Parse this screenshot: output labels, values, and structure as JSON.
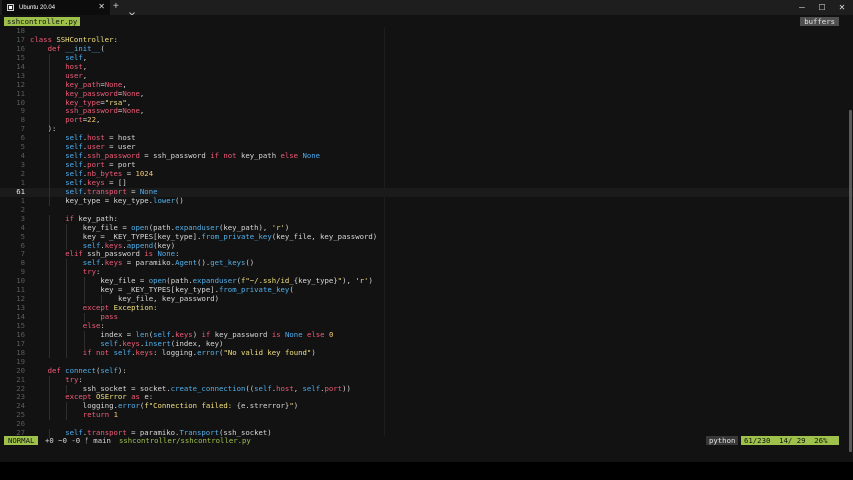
{
  "window": {
    "tab_title": "Ubuntu 20.04",
    "tab_icon": "terminal-icon",
    "close_tab_glyph": "✕",
    "new_tab_glyph": "+",
    "minimize_glyph": "─",
    "maximize_glyph": "☐",
    "close_glyph": "✕"
  },
  "editor": {
    "buffer_name": "sshcontroller.py",
    "buffers_label": "buffers",
    "cursor_line": 61,
    "lines": [
      {
        "n": "18",
        "segs": []
      },
      {
        "n": "17",
        "segs": [
          [
            "kw",
            "class "
          ],
          [
            "cls",
            "SSHController"
          ],
          [
            "",
            ":"
          ]
        ]
      },
      {
        "n": "16",
        "i": 1,
        "segs": [
          [
            "kw",
            "def "
          ],
          [
            "fn",
            "__init__"
          ],
          [
            "",
            "("
          ]
        ]
      },
      {
        "n": "15",
        "i": 2,
        "segs": [
          [
            "sf",
            "self"
          ],
          [
            "",
            ","
          ]
        ]
      },
      {
        "n": "14",
        "i": 2,
        "segs": [
          [
            "pr",
            "host"
          ],
          [
            "",
            ","
          ]
        ]
      },
      {
        "n": "13",
        "i": 2,
        "segs": [
          [
            "pr",
            "user"
          ],
          [
            "",
            ","
          ]
        ]
      },
      {
        "n": "12",
        "i": 2,
        "segs": [
          [
            "pr",
            "key_path"
          ],
          [
            "",
            "="
          ],
          [
            "kw",
            "None"
          ],
          [
            "",
            ","
          ]
        ]
      },
      {
        "n": "11",
        "i": 2,
        "segs": [
          [
            "pr",
            "key_password"
          ],
          [
            "",
            "="
          ],
          [
            "kw",
            "None"
          ],
          [
            "",
            ","
          ]
        ]
      },
      {
        "n": "10",
        "i": 2,
        "segs": [
          [
            "pr",
            "key_type"
          ],
          [
            "",
            "="
          ],
          [
            "st",
            "\"rsa\""
          ],
          [
            "",
            ","
          ]
        ]
      },
      {
        "n": "9",
        "i": 2,
        "segs": [
          [
            "pr",
            "ssh_password"
          ],
          [
            "",
            "="
          ],
          [
            "kw",
            "None"
          ],
          [
            "",
            ","
          ]
        ]
      },
      {
        "n": "8",
        "i": 2,
        "segs": [
          [
            "pr",
            "port"
          ],
          [
            "",
            "="
          ],
          [
            "nm",
            "22"
          ],
          [
            "",
            ","
          ]
        ]
      },
      {
        "n": "7",
        "i": 1,
        "segs": [
          [
            "",
            "):"
          ]
        ]
      },
      {
        "n": "6",
        "i": 2,
        "segs": [
          [
            "sf",
            "self"
          ],
          [
            "",
            "."
          ],
          [
            "pr",
            "host"
          ],
          [
            "",
            " = host"
          ]
        ]
      },
      {
        "n": "5",
        "i": 2,
        "segs": [
          [
            "sf",
            "self"
          ],
          [
            "",
            "."
          ],
          [
            "pr",
            "user"
          ],
          [
            "",
            " = user"
          ]
        ]
      },
      {
        "n": "4",
        "i": 2,
        "segs": [
          [
            "sf",
            "self"
          ],
          [
            "",
            "."
          ],
          [
            "pr",
            "ssh_password"
          ],
          [
            "",
            " = ssh_password "
          ],
          [
            "kw",
            "if not"
          ],
          [
            "",
            " key_path "
          ],
          [
            "kw",
            "else"
          ],
          [
            "",
            " "
          ],
          [
            "sf",
            "None"
          ]
        ]
      },
      {
        "n": "3",
        "i": 2,
        "segs": [
          [
            "sf",
            "self"
          ],
          [
            "",
            "."
          ],
          [
            "pr",
            "port"
          ],
          [
            "",
            " = port"
          ]
        ]
      },
      {
        "n": "2",
        "i": 2,
        "segs": [
          [
            "sf",
            "self"
          ],
          [
            "",
            "."
          ],
          [
            "pr",
            "nb_bytes"
          ],
          [
            "",
            " = "
          ],
          [
            "nm",
            "1024"
          ]
        ]
      },
      {
        "n": "1",
        "i": 2,
        "segs": [
          [
            "sf",
            "self"
          ],
          [
            "",
            "."
          ],
          [
            "pr",
            "keys"
          ],
          [
            "",
            " = []"
          ]
        ]
      },
      {
        "n": "61",
        "i": 2,
        "cur": true,
        "segs": [
          [
            "sf",
            "self"
          ],
          [
            "",
            "."
          ],
          [
            "pr",
            "transport"
          ],
          [
            "",
            " = "
          ],
          [
            "sf",
            "None"
          ]
        ]
      },
      {
        "n": "1",
        "i": 2,
        "segs": [
          [
            "",
            "key_type = key_type."
          ],
          [
            "fn",
            "lower"
          ],
          [
            "",
            "()"
          ]
        ]
      },
      {
        "n": "2",
        "segs": []
      },
      {
        "n": "3",
        "i": 2,
        "segs": [
          [
            "kw",
            "if"
          ],
          [
            "",
            " key_path:"
          ]
        ]
      },
      {
        "n": "4",
        "i": 3,
        "segs": [
          [
            "",
            "key_file = "
          ],
          [
            "fn",
            "open"
          ],
          [
            "",
            "(path."
          ],
          [
            "fn",
            "expanduser"
          ],
          [
            "",
            "(key_path), "
          ],
          [
            "st",
            "'r'"
          ],
          [
            "",
            ")"
          ]
        ]
      },
      {
        "n": "5",
        "i": 3,
        "segs": [
          [
            "",
            "key = _KEY_TYPES[key_type]."
          ],
          [
            "fn",
            "from_private_key"
          ],
          [
            "",
            "(key_file, key_password)"
          ]
        ]
      },
      {
        "n": "6",
        "i": 3,
        "segs": [
          [
            "sf",
            "self"
          ],
          [
            "",
            "."
          ],
          [
            "pr",
            "keys"
          ],
          [
            "",
            "."
          ],
          [
            "fn",
            "append"
          ],
          [
            "",
            "(key)"
          ]
        ]
      },
      {
        "n": "7",
        "i": 2,
        "segs": [
          [
            "kw",
            "elif"
          ],
          [
            "",
            " ssh_password "
          ],
          [
            "kw",
            "is"
          ],
          [
            "",
            " "
          ],
          [
            "sf",
            "None"
          ],
          [
            "",
            ":"
          ]
        ]
      },
      {
        "n": "8",
        "i": 3,
        "segs": [
          [
            "sf",
            "self"
          ],
          [
            "",
            "."
          ],
          [
            "pr",
            "keys"
          ],
          [
            "",
            " = paramiko."
          ],
          [
            "fn",
            "Agent"
          ],
          [
            "",
            "()."
          ],
          [
            "fn",
            "get_keys"
          ],
          [
            "",
            "()"
          ]
        ]
      },
      {
        "n": "9",
        "i": 3,
        "segs": [
          [
            "kw",
            "try"
          ],
          [
            "",
            ":"
          ]
        ]
      },
      {
        "n": "10",
        "i": 4,
        "segs": [
          [
            "",
            "key_file = "
          ],
          [
            "fn",
            "open"
          ],
          [
            "",
            "(path."
          ],
          [
            "fn",
            "expanduser"
          ],
          [
            "",
            "("
          ],
          [
            "st",
            "f\"~/.ssh/id_"
          ],
          [
            "",
            "{key_type}"
          ],
          [
            "st",
            "\""
          ],
          [
            "",
            "), "
          ],
          [
            "st",
            "'r'"
          ],
          [
            "",
            ")"
          ]
        ]
      },
      {
        "n": "11",
        "i": 4,
        "segs": [
          [
            "",
            "key = _KEY_TYPES[key_type]."
          ],
          [
            "fn",
            "from_private_key"
          ],
          [
            "",
            "("
          ]
        ]
      },
      {
        "n": "12",
        "i": 5,
        "segs": [
          [
            "",
            "key_file, key_password)"
          ]
        ]
      },
      {
        "n": "13",
        "i": 3,
        "segs": [
          [
            "kw",
            "except"
          ],
          [
            "",
            " "
          ],
          [
            "cls",
            "Exception"
          ],
          [
            "",
            ":"
          ]
        ]
      },
      {
        "n": "14",
        "i": 4,
        "segs": [
          [
            "kw",
            "pass"
          ]
        ]
      },
      {
        "n": "15",
        "i": 3,
        "segs": [
          [
            "kw",
            "else"
          ],
          [
            "",
            ":"
          ]
        ]
      },
      {
        "n": "16",
        "i": 4,
        "segs": [
          [
            "",
            "index = "
          ],
          [
            "fn",
            "len"
          ],
          [
            "",
            "("
          ],
          [
            "sf",
            "self"
          ],
          [
            "",
            "."
          ],
          [
            "pr",
            "keys"
          ],
          [
            "",
            ") "
          ],
          [
            "kw",
            "if"
          ],
          [
            "",
            " key_password "
          ],
          [
            "kw",
            "is"
          ],
          [
            "",
            " "
          ],
          [
            "sf",
            "None"
          ],
          [
            "",
            " "
          ],
          [
            "kw",
            "else"
          ],
          [
            "",
            " "
          ],
          [
            "nm",
            "0"
          ]
        ]
      },
      {
        "n": "17",
        "i": 4,
        "segs": [
          [
            "sf",
            "self"
          ],
          [
            "",
            "."
          ],
          [
            "pr",
            "keys"
          ],
          [
            "",
            "."
          ],
          [
            "fn",
            "insert"
          ],
          [
            "",
            "(index, key)"
          ]
        ]
      },
      {
        "n": "18",
        "i": 3,
        "segs": [
          [
            "kw",
            "if not"
          ],
          [
            "",
            " "
          ],
          [
            "sf",
            "self"
          ],
          [
            "",
            "."
          ],
          [
            "pr",
            "keys"
          ],
          [
            "",
            ": logging."
          ],
          [
            "fn",
            "error"
          ],
          [
            "",
            "("
          ],
          [
            "st",
            "\"No valid key found\""
          ],
          [
            "",
            ")"
          ]
        ]
      },
      {
        "n": "19",
        "segs": []
      },
      {
        "n": "20",
        "i": 1,
        "segs": [
          [
            "kw",
            "def "
          ],
          [
            "fn",
            "connect"
          ],
          [
            "",
            "("
          ],
          [
            "sf",
            "self"
          ],
          [
            "",
            "):"
          ]
        ]
      },
      {
        "n": "21",
        "i": 2,
        "segs": [
          [
            "kw",
            "try"
          ],
          [
            "",
            ":"
          ]
        ]
      },
      {
        "n": "22",
        "i": 3,
        "segs": [
          [
            "",
            "ssh_socket = socket."
          ],
          [
            "fn",
            "create_connection"
          ],
          [
            "",
            "(("
          ],
          [
            "sf",
            "self"
          ],
          [
            "",
            "."
          ],
          [
            "pr",
            "host"
          ],
          [
            "",
            ", "
          ],
          [
            "sf",
            "self"
          ],
          [
            "",
            "."
          ],
          [
            "pr",
            "port"
          ],
          [
            "",
            "))"
          ]
        ]
      },
      {
        "n": "23",
        "i": 2,
        "segs": [
          [
            "kw",
            "except"
          ],
          [
            "",
            " "
          ],
          [
            "cls",
            "OSError"
          ],
          [
            "",
            " "
          ],
          [
            "kw",
            "as"
          ],
          [
            "",
            " e:"
          ]
        ]
      },
      {
        "n": "24",
        "i": 3,
        "segs": [
          [
            "",
            "logging."
          ],
          [
            "fn",
            "error"
          ],
          [
            "",
            "("
          ],
          [
            "st",
            "f\"Connection failed: "
          ],
          [
            "",
            "{e.strerror}"
          ],
          [
            "st",
            "\""
          ],
          [
            "",
            ")"
          ]
        ]
      },
      {
        "n": "25",
        "i": 3,
        "segs": [
          [
            "kw",
            "return"
          ],
          [
            "",
            " "
          ],
          [
            "nm",
            "1"
          ]
        ]
      },
      {
        "n": "26",
        "segs": []
      },
      {
        "n": "27",
        "i": 2,
        "segs": [
          [
            "sf",
            "self"
          ],
          [
            "",
            "."
          ],
          [
            "pr",
            "transport"
          ],
          [
            "",
            " = paramiko."
          ],
          [
            "fn",
            "Transport"
          ],
          [
            "",
            "(ssh_socket)"
          ]
        ]
      }
    ]
  },
  "statusline": {
    "mode": "NORMAL",
    "git": "+0 ~0 -0 ᚠ main",
    "file_path": "sshcontroller/sshcontroller.py",
    "filetype": "python",
    "position": "61/230  14/ 29  26%"
  },
  "colors": {
    "accent": "#9ec14c",
    "keyword": "#f05a78",
    "function": "#53b0ea",
    "string": "#f0e080",
    "background": "#121212"
  }
}
